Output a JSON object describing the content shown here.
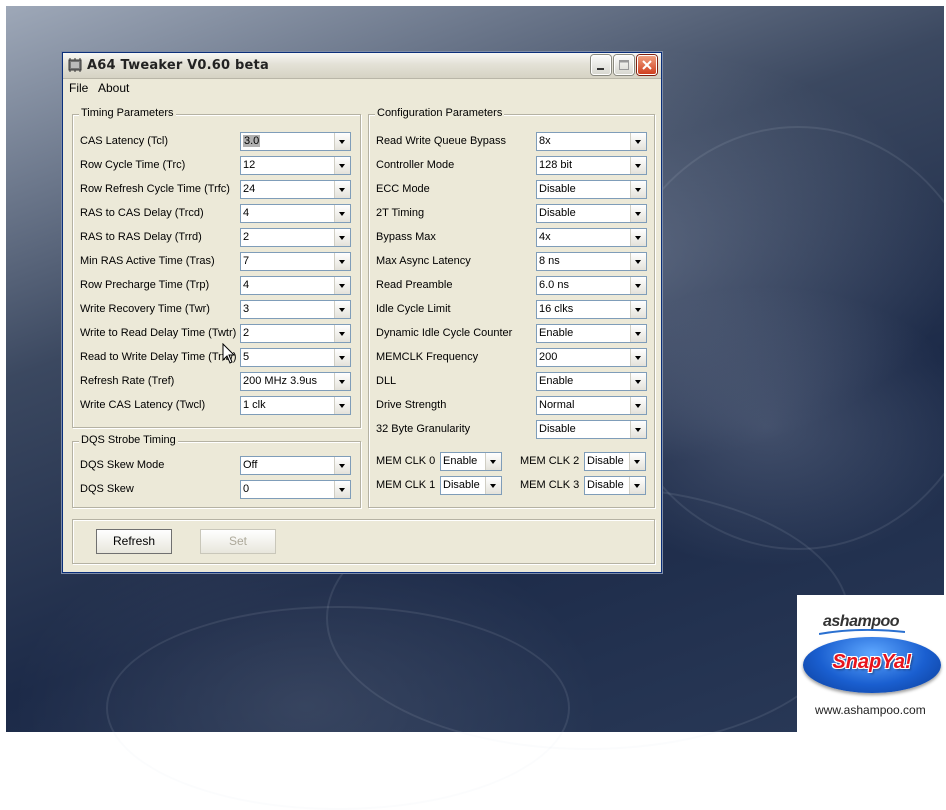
{
  "window": {
    "title": "A64 Tweaker V0.60 beta"
  },
  "menu": {
    "file": "File",
    "about": "About"
  },
  "timing": {
    "title": "Timing Parameters",
    "rows": [
      {
        "label": "CAS Latency (Tcl)",
        "value": "3.0"
      },
      {
        "label": "Row Cycle Time (Trc)",
        "value": "12"
      },
      {
        "label": "Row Refresh Cycle Time (Trfc)",
        "value": "24"
      },
      {
        "label": "RAS to CAS Delay (Trcd)",
        "value": "4"
      },
      {
        "label": "RAS to RAS Delay (Trrd)",
        "value": "2"
      },
      {
        "label": "Min RAS Active Time (Tras)",
        "value": "7"
      },
      {
        "label": "Row Precharge Time (Trp)",
        "value": "4"
      },
      {
        "label": "Write Recovery Time (Twr)",
        "value": "3"
      },
      {
        "label": "Write to Read Delay Time (Twtr)",
        "value": "2"
      },
      {
        "label": "Read to Write Delay Time (Trtw)",
        "value": "5"
      },
      {
        "label": "Refresh Rate (Tref)",
        "value": "200 MHz 3.9us"
      },
      {
        "label": "Write CAS Latency (Twcl)",
        "value": "1 clk"
      }
    ]
  },
  "dqs": {
    "title": "DQS Strobe Timing",
    "rows": [
      {
        "label": "DQS Skew Mode",
        "value": "Off"
      },
      {
        "label": "DQS Skew",
        "value": "0"
      }
    ]
  },
  "config": {
    "title": "Configuration Parameters",
    "rows": [
      {
        "label": "Read Write Queue Bypass",
        "value": "8x"
      },
      {
        "label": "Controller Mode",
        "value": "128 bit"
      },
      {
        "label": "ECC Mode",
        "value": "Disable"
      },
      {
        "label": "2T Timing",
        "value": "Disable"
      },
      {
        "label": "Bypass Max",
        "value": "4x"
      },
      {
        "label": "Max Async Latency",
        "value": "8 ns"
      },
      {
        "label": "Read Preamble",
        "value": "6.0 ns"
      },
      {
        "label": "Idle Cycle Limit",
        "value": "16 clks"
      },
      {
        "label": "Dynamic Idle Cycle Counter",
        "value": "Enable"
      },
      {
        "label": "MEMCLK Frequency",
        "value": "200"
      },
      {
        "label": "DLL",
        "value": "Enable"
      },
      {
        "label": "Drive Strength",
        "value": "Normal"
      },
      {
        "label": "32 Byte Granularity",
        "value": "Disable"
      }
    ],
    "memclk": [
      {
        "label": "MEM CLK 0",
        "value": "Enable"
      },
      {
        "label": "MEM CLK 2",
        "value": "Disable"
      },
      {
        "label": "MEM CLK 1",
        "value": "Disable"
      },
      {
        "label": "MEM CLK 3",
        "value": "Disable"
      }
    ]
  },
  "buttons": {
    "refresh": "Refresh",
    "set": "Set"
  },
  "badge": {
    "brand": "ashampoo",
    "product": "SnapYa!",
    "url": "www.ashampoo.com"
  },
  "icons": [
    "app-icon",
    "minimize-icon",
    "maximize-icon",
    "close-icon",
    "dropdown-arrow-icon",
    "mouse-cursor-icon"
  ]
}
